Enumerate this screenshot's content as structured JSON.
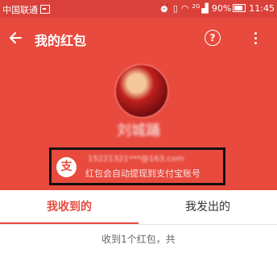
{
  "status_bar": {
    "carrier": "中国联通",
    "network": "2G",
    "battery": "90%",
    "time": "11:45"
  },
  "header": {
    "title": "我的红包",
    "help_label": "?"
  },
  "profile": {
    "name": "刘城踊"
  },
  "account": {
    "icon_label": "支",
    "email": "15221321***@163.com",
    "note": "红包会自动提现到支付宝账号"
  },
  "tabs": [
    {
      "label": "我收到的"
    },
    {
      "label": "我发出的"
    }
  ],
  "summary": {
    "text": "收到1个红包，共"
  },
  "colors": {
    "accent": "#e84a3e"
  }
}
